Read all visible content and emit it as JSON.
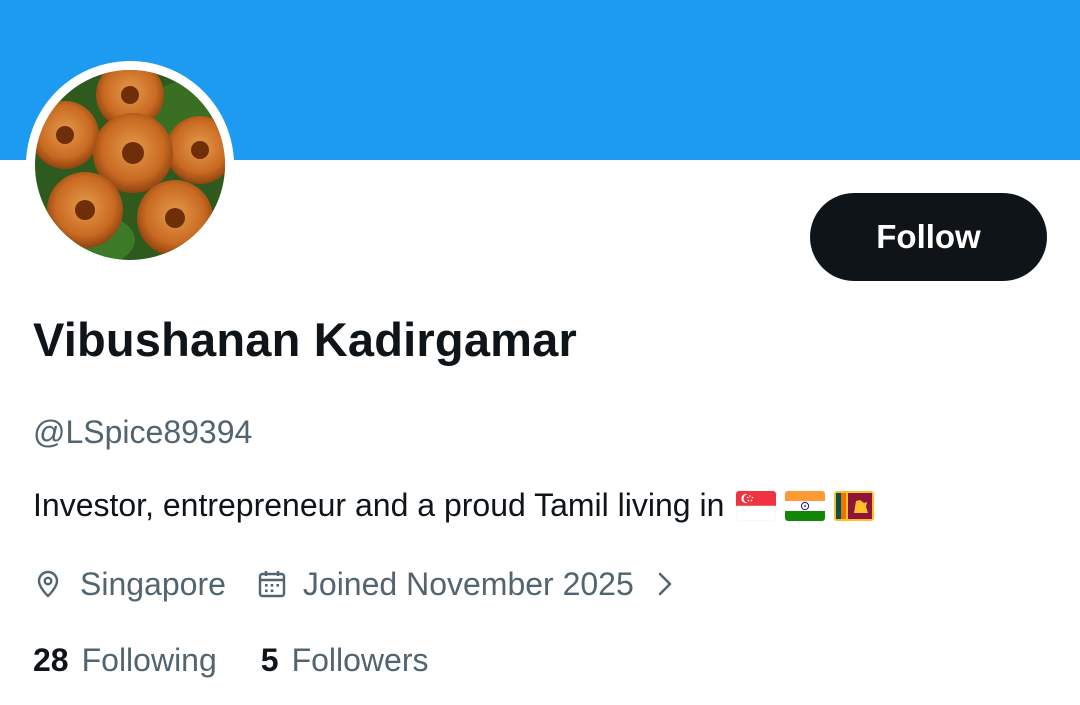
{
  "profile": {
    "display_name": "Vibushanan Kadirgamar",
    "handle": "@LSpice89394",
    "bio": "Investor, entrepreneur and a proud Tamil living in",
    "bio_flags": [
      "singapore-flag",
      "india-flag",
      "sri-lanka-flag"
    ],
    "location": "Singapore",
    "joined": "Joined November 2025",
    "following_count": "28",
    "following_label": "Following",
    "followers_count": "5",
    "followers_label": "Followers"
  },
  "actions": {
    "follow_label": "Follow"
  },
  "icons": {
    "location": "location-pin-icon",
    "calendar": "calendar-icon",
    "more": "chevron-right-icon"
  },
  "colors": {
    "banner": "#1d9bf0",
    "primary_text": "#0f1419",
    "secondary_text": "#536471",
    "follow_button_bg": "#0f1419",
    "follow_button_text": "#ffffff"
  }
}
